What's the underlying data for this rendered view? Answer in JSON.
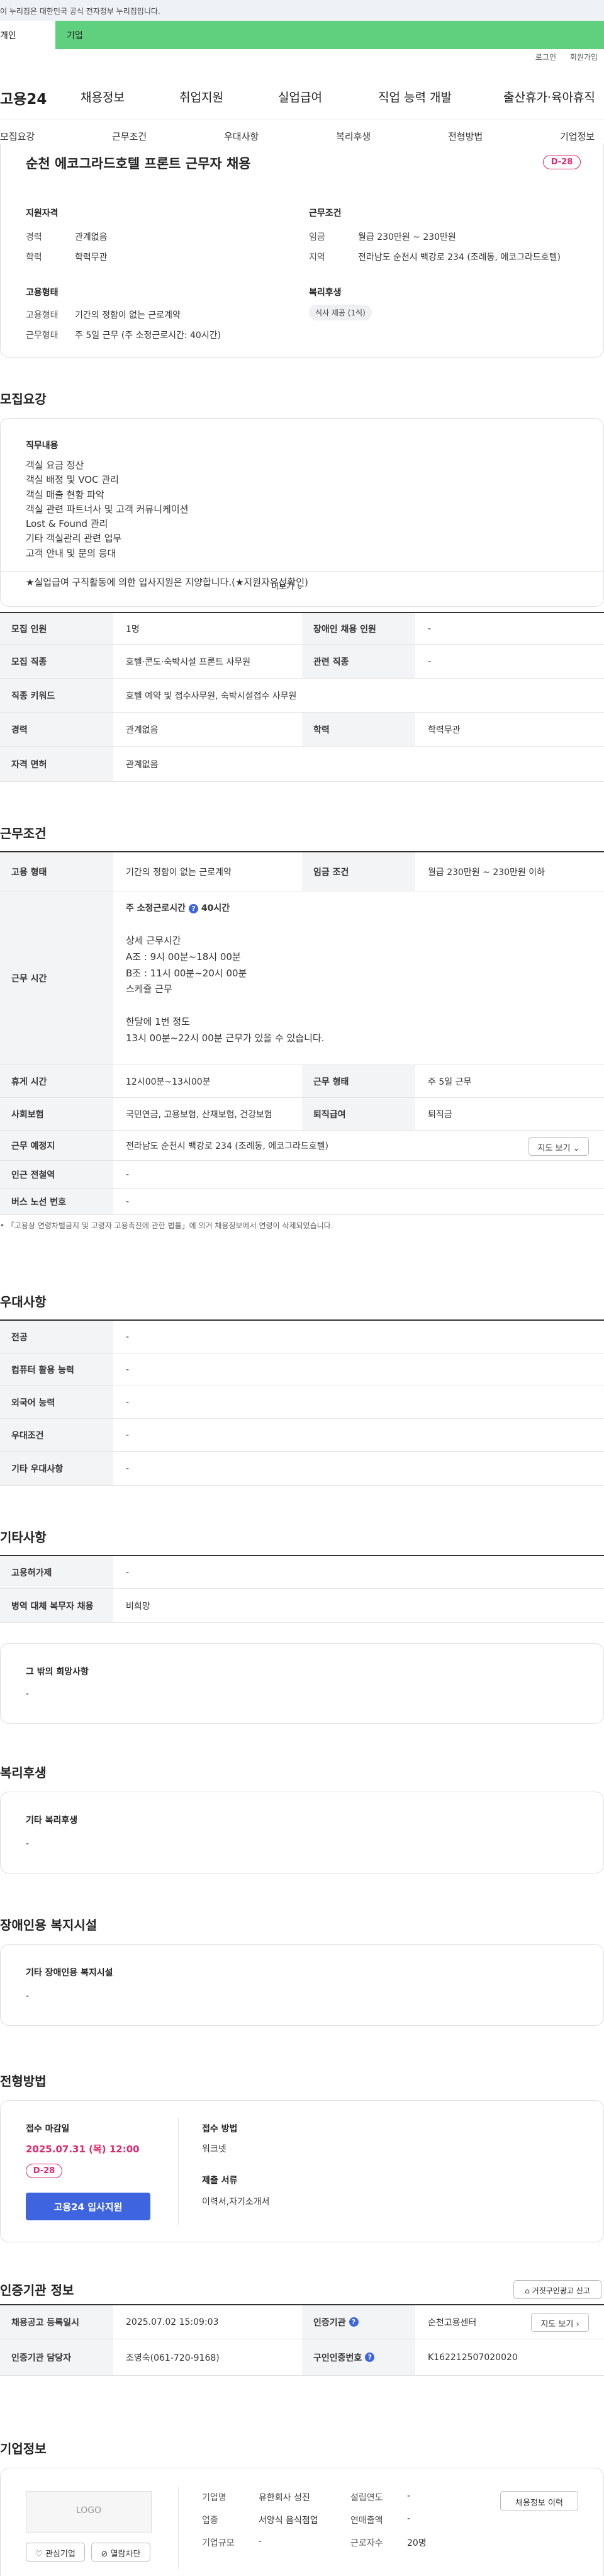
{
  "banner": {
    "text": "이 누리집은 대한민국 공식 전자정부 누리집입니다."
  },
  "site_tabs": {
    "personal": "개인",
    "company": "기업"
  },
  "util": {
    "login": "로그인",
    "join": "회원가입"
  },
  "gnb": {
    "logo": "고용24",
    "items": [
      "채용정보",
      "취업지원",
      "실업급여",
      "직업 능력 개발",
      "출산휴가·육아휴직"
    ]
  },
  "subnav": {
    "items": [
      "모집요강",
      "근무조건",
      "우대사항",
      "복리후생",
      "전형방법",
      "기업정보"
    ]
  },
  "summary": {
    "title": "순천 에코그라드호텔 프론트 근무자 채용",
    "dday": "D-28",
    "qual_heading": "지원자격",
    "career_k": "경력",
    "career_v": "관계없음",
    "edu_k": "학력",
    "edu_v": "학력무관",
    "cond_heading": "근무조건",
    "wage_k": "임금",
    "wage_v": "월급 230만원 ~ 230만원",
    "region_k": "지역",
    "region_v": "전라남도 순천시 백강로 234 (조례동, 에코그라드호텔)",
    "emp_heading": "고용형태",
    "emptype_k": "고용형태",
    "emptype_v": "기간의 정함이 없는 근로계약",
    "worktype_k": "근무형태",
    "worktype_v": "주 5일 근무 (주 소정근로시간: 40시간)",
    "welfare_heading": "복리후생",
    "welfare_badge": "식사 제공 (1식)"
  },
  "recruit": {
    "heading": "모집요강",
    "duty_heading": "직무내용",
    "duty_text": "객실 요금 정산\n객실 배정 및 VOC 관리\n객실 매출 현황 파악\n객실 관련 파트너사 및 고객 커뮤니케이션\nLost & Found 관리\n기타 객실관리 관련 업무\n고객 안내 및 문의 응대\n\n★실업급여 구직활동에 의한 입사지원은 지양합니다.(★지원자유선확인)",
    "more": "더보기",
    "rows": {
      "count_k": "모집 인원",
      "count_v": "1명",
      "disabled_k": "장애인 채용 인원",
      "disabled_v": "-",
      "job_k": "모집 직종",
      "job_v": "호텔·콘도·숙박시설 프론트 사무원",
      "related_k": "관련 직종",
      "related_v": "-",
      "keyword_k": "직종 키워드",
      "keyword_v": "호텔 예약 및 접수사무원, 숙박시설접수 사무원",
      "career_k": "경력",
      "career_v": "관계없음",
      "edu_k": "학력",
      "edu_v": "학력무관",
      "license_k": "자격 면허",
      "license_v": "관계없음"
    }
  },
  "work": {
    "heading": "근무조건",
    "emptype_k": "고용 형태",
    "emptype_v": "기간의 정함이 없는 근로계약",
    "wage_k": "임금 조건",
    "wage_v": "월급 230만원 ~ 230만원 이하",
    "hours_k": "근무 시간",
    "hours_title": "주 소정근로시간",
    "hours_total": "40시간",
    "hours_detail": "상세 근무시간\nA조 : 9시 00분~18시 00분\nB조 : 11시 00분~20시 00분\n스케쥴 근무\n\n한달에 1번 정도\n13시 00분~22시 00분 근무가 있을 수 있습니다.",
    "break_k": "휴게 시간",
    "break_v": "12시00분~13시00분",
    "form_k": "근무 형태",
    "form_v": "주 5일 근무",
    "insurance_k": "사회보험",
    "insurance_v": "국민연금, 고용보험, 산재보험, 건강보험",
    "retire_k": "퇴직급여",
    "retire_v": "퇴직금",
    "place_k": "근무 예정지",
    "place_v": "전라남도 순천시 백강로 234 (조례동, 에코그라드호텔)",
    "map_btn": "지도 보기",
    "subway_k": "인근 전철역",
    "subway_v": "-",
    "bus_k": "버스 노선 번호",
    "bus_v": "-",
    "note": "「고용상 연령차별금지 및 고령자 고용촉진에 관한 법률」에 의거 채용정보에서 연령이 삭제되었습니다."
  },
  "pref": {
    "heading": "우대사항",
    "rows": [
      {
        "k": "전공",
        "v": "-"
      },
      {
        "k": "컴퓨터 활용 능력",
        "v": "-"
      },
      {
        "k": "외국어 능력",
        "v": "-"
      },
      {
        "k": "우대조건",
        "v": "-"
      },
      {
        "k": "기타 우대사항",
        "v": "-"
      }
    ]
  },
  "etc": {
    "heading": "기타사항",
    "rows": [
      {
        "k": "고용허가제",
        "v": "-"
      },
      {
        "k": "병역 대체 복무자 채용",
        "v": "비희망"
      }
    ],
    "other_heading": "그 밖의 희망사항",
    "other_v": "-"
  },
  "welfare": {
    "heading": "복리후생",
    "box_heading": "기타 복리후생",
    "box_v": "-"
  },
  "disabled": {
    "heading": "장애인용 복지시설",
    "box_heading": "기타 장애인용 복지시설",
    "box_v": "-"
  },
  "screening": {
    "heading": "전형방법",
    "deadline_k": "접수 마감일",
    "deadline_v": "2025.07.31 (목) 12:00",
    "dday": "D-28",
    "apply_btn": "고용24 입사지원",
    "method_k": "접수 방법",
    "method_v": "워크넷",
    "docs_k": "제출 서류",
    "docs_v": "이력서,자기소개서"
  },
  "cert": {
    "heading": "인증기관 정보",
    "report_btn": "거짓구인광고 신고",
    "reg_k": "채용공고 등록일시",
    "reg_v": "2025.07.02 15:09:03",
    "agency_k": "인증기관",
    "agency_v": "순천고용센터",
    "map_btn": "지도 보기",
    "manager_k": "인증기관 담당자",
    "manager_v": "조영숙(061-720-9168)",
    "reqno_k": "구인인증번호",
    "reqno_v": "K162212507020020"
  },
  "company": {
    "heading": "기업정보",
    "logo": "LOGO",
    "fav_btn": "관심기업",
    "block_btn": "열람차단",
    "history_btn": "채용정보 이력",
    "name_k": "기업명",
    "name_v": "유한회사 성진",
    "founded_k": "설립연도",
    "founded_v": "-",
    "industry_k": "업종",
    "industry_v": "서양식 음식점업",
    "revenue_k": "연매출액",
    "revenue_v": "-",
    "size_k": "기업규모",
    "size_v": "-",
    "workers_k": "근로자수",
    "workers_v": "20명"
  }
}
